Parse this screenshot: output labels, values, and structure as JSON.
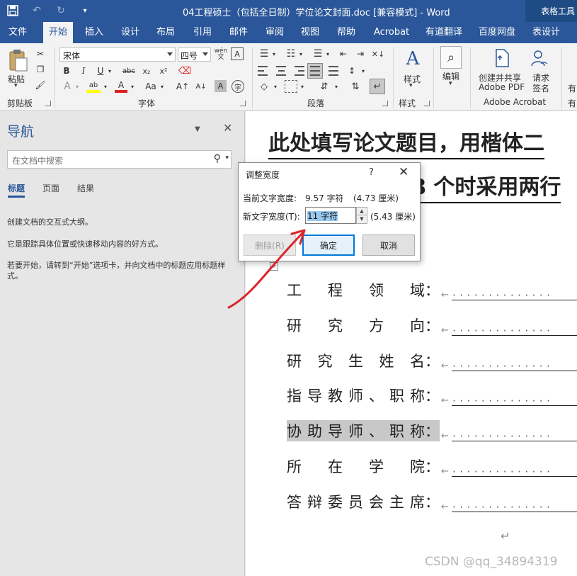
{
  "window": {
    "title": "04工程硕士（包括全日制）学位论文封面.doc [兼容模式] - Word",
    "context_tab": "表格工具"
  },
  "tabs": [
    {
      "label": "文件"
    },
    {
      "label": "开始"
    },
    {
      "label": "插入"
    },
    {
      "label": "设计"
    },
    {
      "label": "布局"
    },
    {
      "label": "引用"
    },
    {
      "label": "邮件"
    },
    {
      "label": "审阅"
    },
    {
      "label": "视图"
    },
    {
      "label": "帮助"
    },
    {
      "label": "Acrobat"
    },
    {
      "label": "有道翻译"
    },
    {
      "label": "百度网盘"
    },
    {
      "label": "表设计"
    }
  ],
  "ribbon": {
    "clipboard": {
      "paste": "粘贴",
      "group": "剪贴板"
    },
    "font": {
      "family": "宋体",
      "size": "四号",
      "group": "字体",
      "phonetic": "wén"
    },
    "paragraph": {
      "group": "段落"
    },
    "styles": {
      "label": "样式",
      "group": "样式"
    },
    "editing": {
      "label": "编辑"
    },
    "adobe": {
      "create_share": "创建并共享",
      "adobe_pdf": "Adobe PDF",
      "request": "请求",
      "sign": "签名",
      "group": "Adobe Acrobat"
    },
    "truncated_label": "有"
  },
  "nav": {
    "title": "导航",
    "search_placeholder": "在文档中搜索",
    "tabs": [
      "标题",
      "页面",
      "结果"
    ],
    "text1": "创建文档的交互式大纲。",
    "text2": "它是跟踪具体位置或快速移动内容的好方式。",
    "text3": "若要开始，请转到“开始”选项卡，并向文档中的标题应用标题样式。"
  },
  "document": {
    "title_line1": "此处填写论文题目，用楷体二",
    "title_line2": "8 个时采用两行",
    "rows": [
      {
        "chars": [
          "工",
          "程",
          "领",
          "域："
        ]
      },
      {
        "chars": [
          "研",
          "究",
          "方",
          "向："
        ]
      },
      {
        "chars": [
          "研",
          "究",
          "生",
          "姓",
          "名："
        ]
      },
      {
        "chars": [
          "指",
          "导",
          "教",
          "师",
          "、",
          "职",
          "称："
        ]
      },
      {
        "chars": [
          "协",
          "助",
          "导",
          "师",
          "、",
          "职",
          "称："
        ]
      },
      {
        "chars": [
          "所",
          "在",
          "学",
          "院："
        ]
      },
      {
        "chars": [
          "答",
          "辩",
          "委",
          "员",
          "会",
          "主",
          "席："
        ]
      }
    ],
    "dots": "··············",
    "para_mark": "↵"
  },
  "dialog": {
    "title": "调整宽度",
    "help": "?",
    "current_label": "当前文字宽度:",
    "current_value": "9.57 字符",
    "current_cm": "(4.73 厘米)",
    "new_label": "新文字宽度(T):",
    "new_value": "11 字符",
    "new_cm": "(5.43 厘米)",
    "delete_btn": "删除(R)",
    "ok_btn": "确定",
    "cancel_btn": "取消"
  },
  "watermark": "CSDN @qq_34894319",
  "colors": {
    "accent": "#2b579a",
    "annotation_arrow": "#d9262b"
  }
}
